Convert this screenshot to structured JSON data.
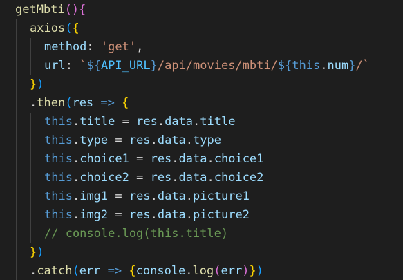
{
  "editor": {
    "lines": [
      {
        "indent": 0,
        "tokens": [
          {
            "t": "getMbti",
            "c": "#dcdcaa"
          },
          {
            "t": "()",
            "c": "#da70d6"
          },
          {
            "t": "{",
            "c": "#da70d6"
          }
        ]
      },
      {
        "indent": 1,
        "tokens": [
          {
            "t": "axios",
            "c": "#dcdcaa"
          },
          {
            "t": "(",
            "c": "#179fff"
          },
          {
            "t": "{",
            "c": "#ffd700"
          }
        ]
      },
      {
        "indent": 2,
        "tokens": [
          {
            "t": "method",
            "c": "#9cdcfe"
          },
          {
            "t": ": ",
            "c": "#d4d4d4"
          },
          {
            "t": "'get'",
            "c": "#ce9178"
          },
          {
            "t": ",",
            "c": "#d4d4d4"
          }
        ]
      },
      {
        "indent": 2,
        "tokens": [
          {
            "t": "url",
            "c": "#9cdcfe"
          },
          {
            "t": ": ",
            "c": "#d4d4d4"
          },
          {
            "t": "`",
            "c": "#ce9178"
          },
          {
            "t": "${",
            "c": "#569cd6"
          },
          {
            "t": "API_URL",
            "c": "#4fc1ff"
          },
          {
            "t": "}",
            "c": "#569cd6"
          },
          {
            "t": "/api/movies/mbti/",
            "c": "#ce9178"
          },
          {
            "t": "${",
            "c": "#569cd6"
          },
          {
            "t": "this",
            "c": "#569cd6"
          },
          {
            "t": ".",
            "c": "#d4d4d4"
          },
          {
            "t": "num",
            "c": "#9cdcfe"
          },
          {
            "t": "}",
            "c": "#569cd6"
          },
          {
            "t": "/`",
            "c": "#ce9178"
          }
        ]
      },
      {
        "indent": 1,
        "tokens": [
          {
            "t": "}",
            "c": "#ffd700"
          },
          {
            "t": ")",
            "c": "#179fff"
          }
        ]
      },
      {
        "indent": 1,
        "tokens": [
          {
            "t": ".",
            "c": "#d4d4d4"
          },
          {
            "t": "then",
            "c": "#dcdcaa"
          },
          {
            "t": "(",
            "c": "#179fff"
          },
          {
            "t": "res",
            "c": "#9cdcfe"
          },
          {
            "t": " ",
            "c": "#d4d4d4"
          },
          {
            "t": "=>",
            "c": "#569cd6"
          },
          {
            "t": " ",
            "c": "#d4d4d4"
          },
          {
            "t": "{",
            "c": "#ffd700"
          }
        ]
      },
      {
        "indent": 2,
        "tokens": [
          {
            "t": "this",
            "c": "#569cd6"
          },
          {
            "t": ".",
            "c": "#d4d4d4"
          },
          {
            "t": "title",
            "c": "#9cdcfe"
          },
          {
            "t": " = ",
            "c": "#d4d4d4"
          },
          {
            "t": "res",
            "c": "#9cdcfe"
          },
          {
            "t": ".",
            "c": "#d4d4d4"
          },
          {
            "t": "data",
            "c": "#9cdcfe"
          },
          {
            "t": ".",
            "c": "#d4d4d4"
          },
          {
            "t": "title",
            "c": "#9cdcfe"
          }
        ]
      },
      {
        "indent": 2,
        "tokens": [
          {
            "t": "this",
            "c": "#569cd6"
          },
          {
            "t": ".",
            "c": "#d4d4d4"
          },
          {
            "t": "type",
            "c": "#9cdcfe"
          },
          {
            "t": " = ",
            "c": "#d4d4d4"
          },
          {
            "t": "res",
            "c": "#9cdcfe"
          },
          {
            "t": ".",
            "c": "#d4d4d4"
          },
          {
            "t": "data",
            "c": "#9cdcfe"
          },
          {
            "t": ".",
            "c": "#d4d4d4"
          },
          {
            "t": "type",
            "c": "#9cdcfe"
          }
        ]
      },
      {
        "indent": 2,
        "tokens": [
          {
            "t": "this",
            "c": "#569cd6"
          },
          {
            "t": ".",
            "c": "#d4d4d4"
          },
          {
            "t": "choice1",
            "c": "#9cdcfe"
          },
          {
            "t": " = ",
            "c": "#d4d4d4"
          },
          {
            "t": "res",
            "c": "#9cdcfe"
          },
          {
            "t": ".",
            "c": "#d4d4d4"
          },
          {
            "t": "data",
            "c": "#9cdcfe"
          },
          {
            "t": ".",
            "c": "#d4d4d4"
          },
          {
            "t": "choice1",
            "c": "#9cdcfe"
          }
        ]
      },
      {
        "indent": 2,
        "tokens": [
          {
            "t": "this",
            "c": "#569cd6"
          },
          {
            "t": ".",
            "c": "#d4d4d4"
          },
          {
            "t": "choice2",
            "c": "#9cdcfe"
          },
          {
            "t": " = ",
            "c": "#d4d4d4"
          },
          {
            "t": "res",
            "c": "#9cdcfe"
          },
          {
            "t": ".",
            "c": "#d4d4d4"
          },
          {
            "t": "data",
            "c": "#9cdcfe"
          },
          {
            "t": ".",
            "c": "#d4d4d4"
          },
          {
            "t": "choice2",
            "c": "#9cdcfe"
          }
        ]
      },
      {
        "indent": 2,
        "tokens": [
          {
            "t": "this",
            "c": "#569cd6"
          },
          {
            "t": ".",
            "c": "#d4d4d4"
          },
          {
            "t": "img1",
            "c": "#9cdcfe"
          },
          {
            "t": " = ",
            "c": "#d4d4d4"
          },
          {
            "t": "res",
            "c": "#9cdcfe"
          },
          {
            "t": ".",
            "c": "#d4d4d4"
          },
          {
            "t": "data",
            "c": "#9cdcfe"
          },
          {
            "t": ".",
            "c": "#d4d4d4"
          },
          {
            "t": "picture1",
            "c": "#9cdcfe"
          }
        ]
      },
      {
        "indent": 2,
        "tokens": [
          {
            "t": "this",
            "c": "#569cd6"
          },
          {
            "t": ".",
            "c": "#d4d4d4"
          },
          {
            "t": "img2",
            "c": "#9cdcfe"
          },
          {
            "t": " = ",
            "c": "#d4d4d4"
          },
          {
            "t": "res",
            "c": "#9cdcfe"
          },
          {
            "t": ".",
            "c": "#d4d4d4"
          },
          {
            "t": "data",
            "c": "#9cdcfe"
          },
          {
            "t": ".",
            "c": "#d4d4d4"
          },
          {
            "t": "picture2",
            "c": "#9cdcfe"
          }
        ]
      },
      {
        "indent": 2,
        "tokens": [
          {
            "t": "// console.log(this.title)",
            "c": "#6a9955"
          }
        ]
      },
      {
        "indent": 1,
        "tokens": [
          {
            "t": "}",
            "c": "#ffd700"
          },
          {
            "t": ")",
            "c": "#179fff"
          }
        ]
      },
      {
        "indent": 1,
        "tokens": [
          {
            "t": ".",
            "c": "#d4d4d4"
          },
          {
            "t": "catch",
            "c": "#dcdcaa"
          },
          {
            "t": "(",
            "c": "#179fff"
          },
          {
            "t": "err",
            "c": "#9cdcfe"
          },
          {
            "t": " ",
            "c": "#d4d4d4"
          },
          {
            "t": "=>",
            "c": "#569cd6"
          },
          {
            "t": " ",
            "c": "#d4d4d4"
          },
          {
            "t": "{",
            "c": "#ffd700"
          },
          {
            "t": "console",
            "c": "#9cdcfe"
          },
          {
            "t": ".",
            "c": "#d4d4d4"
          },
          {
            "t": "log",
            "c": "#dcdcaa"
          },
          {
            "t": "(",
            "c": "#da70d6"
          },
          {
            "t": "err",
            "c": "#9cdcfe"
          },
          {
            "t": ")",
            "c": "#da70d6"
          },
          {
            "t": "}",
            "c": "#ffd700"
          },
          {
            "t": ")",
            "c": "#179fff"
          }
        ]
      }
    ]
  }
}
